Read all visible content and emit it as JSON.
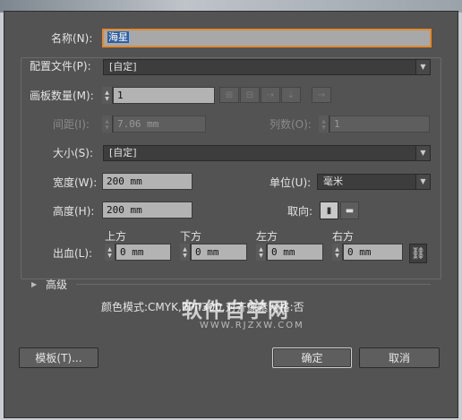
{
  "name": {
    "label": "名称(N):",
    "value": "海星"
  },
  "profile": {
    "label": "配置文件(P):",
    "value": "[自定]"
  },
  "artboards": {
    "count_label": "画板数量(M):",
    "count_value": "1",
    "spacing_label": "间距(I):",
    "spacing_value": "7.06 mm",
    "columns_label": "列数(O):",
    "columns_value": "1"
  },
  "size": {
    "label": "大小(S):",
    "value": "[自定]"
  },
  "width": {
    "label": "宽度(W):",
    "value": "200 mm"
  },
  "units": {
    "label": "单位(U):",
    "value": "毫米"
  },
  "height": {
    "label": "高度(H):",
    "value": "200 mm"
  },
  "orientation": {
    "label": "取向:"
  },
  "bleed": {
    "label": "出血(L):",
    "top_label": "上方",
    "top_value": "0 mm",
    "bottom_label": "下方",
    "bottom_value": "0 mm",
    "left_label": "左方",
    "left_value": "0 mm",
    "right_label": "右方",
    "right_value": "0 mm"
  },
  "advanced": {
    "label": "高级"
  },
  "summary": {
    "text": "颜色模式:CMYK,PPI:300,对齐像素网格:否"
  },
  "watermark": {
    "text": "软件自学网",
    "sub": "WWW.RJZXW.COM"
  },
  "buttons": {
    "templates": "模板(T)...",
    "ok": "确定",
    "cancel": "取消"
  }
}
